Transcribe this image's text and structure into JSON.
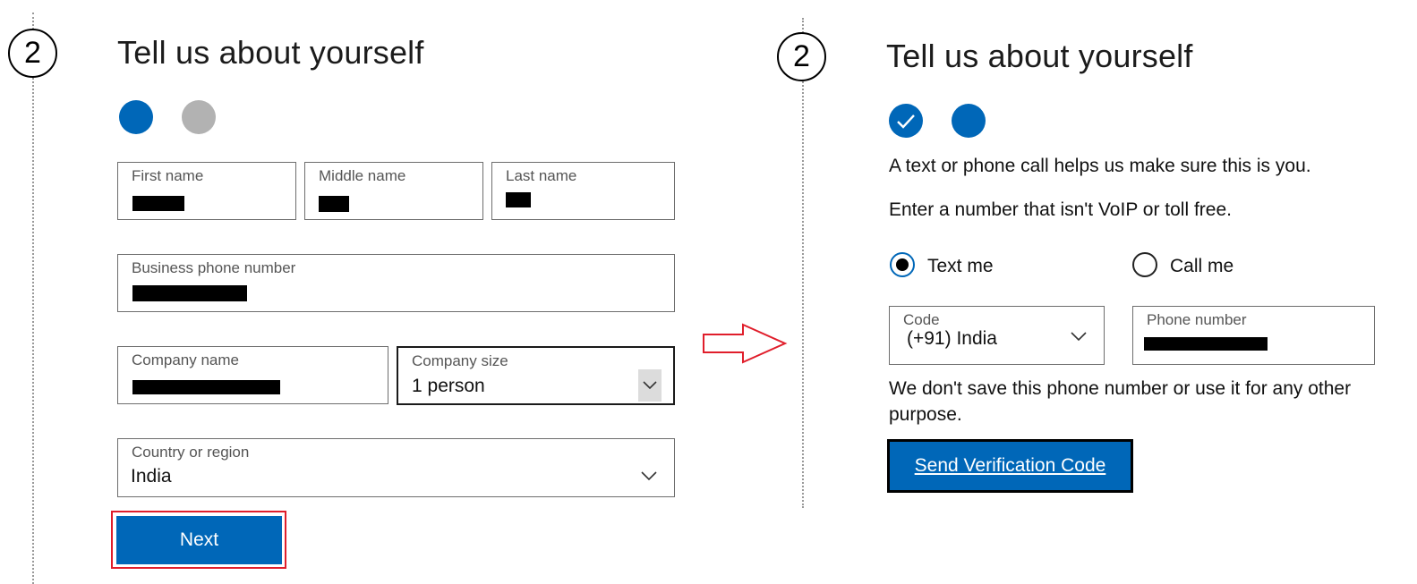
{
  "left_panel": {
    "step_number": "2",
    "title": "Tell us about yourself",
    "first_name": {
      "label": "First name"
    },
    "middle_name": {
      "label": "Middle name"
    },
    "last_name": {
      "label": "Last name"
    },
    "business_phone": {
      "label": "Business phone number"
    },
    "company_name": {
      "label": "Company name"
    },
    "company_size": {
      "label": "Company size",
      "value": "1 person"
    },
    "country": {
      "label": "Country or region",
      "value": "India"
    },
    "next_label": "Next"
  },
  "right_panel": {
    "step_number": "2",
    "title": "Tell us about yourself",
    "info_text": "A text or phone call helps us make sure this is you.",
    "hint_text": "Enter a number that isn't VoIP or toll free.",
    "radio_text_me": "Text me",
    "radio_call_me": "Call me",
    "code": {
      "label": "Code",
      "value": "(+91) India"
    },
    "phone": {
      "label": "Phone number"
    },
    "disclaimer": "We don't save this phone number or use it for any other purpose.",
    "send_label": "Send Verification Code"
  },
  "colors": {
    "accent": "#0067b8",
    "inactive_dot": "#b2b2b2",
    "highlight_red": "#e01e2b",
    "redaction": "#000000"
  },
  "icons": [
    "chevron-down-icon",
    "checkmark-icon",
    "arrow-right-icon"
  ]
}
